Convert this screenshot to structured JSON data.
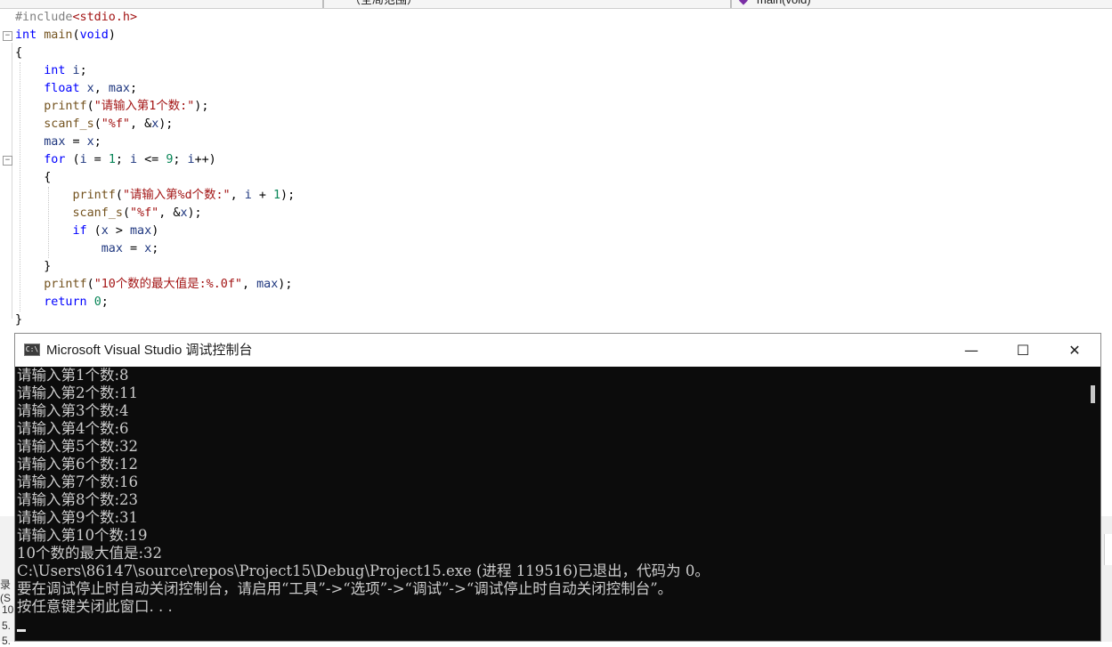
{
  "nav": {
    "scope_label": "（全局范围）",
    "member_label": "main(void)"
  },
  "code": [
    "#include<stdio.h>",
    "int main(void)",
    "{",
    "    int i;",
    "    float x, max;",
    "    printf(\"请输入第1个数:\");",
    "    scanf_s(\"%f\", &x);",
    "    max = x;",
    "    for (i = 1; i <= 9; i++)",
    "    {",
    "        printf(\"请输入第%d个数:\", i + 1);",
    "        scanf_s(\"%f\", &x);",
    "        if (x > max)",
    "            max = x;",
    "    }",
    "    printf(\"10个数的最大值是:%.0f\", max);",
    "    return 0;",
    "}"
  ],
  "side_fragments": {
    "left_top": "录(S",
    "left_line1": "10",
    "left_line2": "5.",
    "left_line3": "5."
  },
  "console": {
    "icon_label": "C:\\",
    "title": "Microsoft Visual Studio 调试控制台",
    "minimize": "—",
    "maximize": "☐",
    "close": "✕",
    "lines": [
      "请输入第1个数:8",
      "请输入第2个数:11",
      "请输入第3个数:4",
      "请输入第4个数:6",
      "请输入第5个数:32",
      "请输入第6个数:12",
      "请输入第7个数:16",
      "请输入第8个数:23",
      "请输入第9个数:31",
      "请输入第10个数:19",
      "10个数的最大值是:32",
      "C:\\Users\\86147\\source\\repos\\Project15\\Debug\\Project15.exe (进程 119516)已退出，代码为 0。",
      "要在调试停止时自动关闭控制台，请启用“工具”->“选项”->“调试”->“调试停止时自动关闭控制台”。",
      "按任意键关闭此窗口. . ."
    ]
  },
  "colors": {
    "keyword": "#0000ff",
    "string": "#a31515",
    "console_bg": "#0c0c0c",
    "console_text": "#cccccc"
  }
}
